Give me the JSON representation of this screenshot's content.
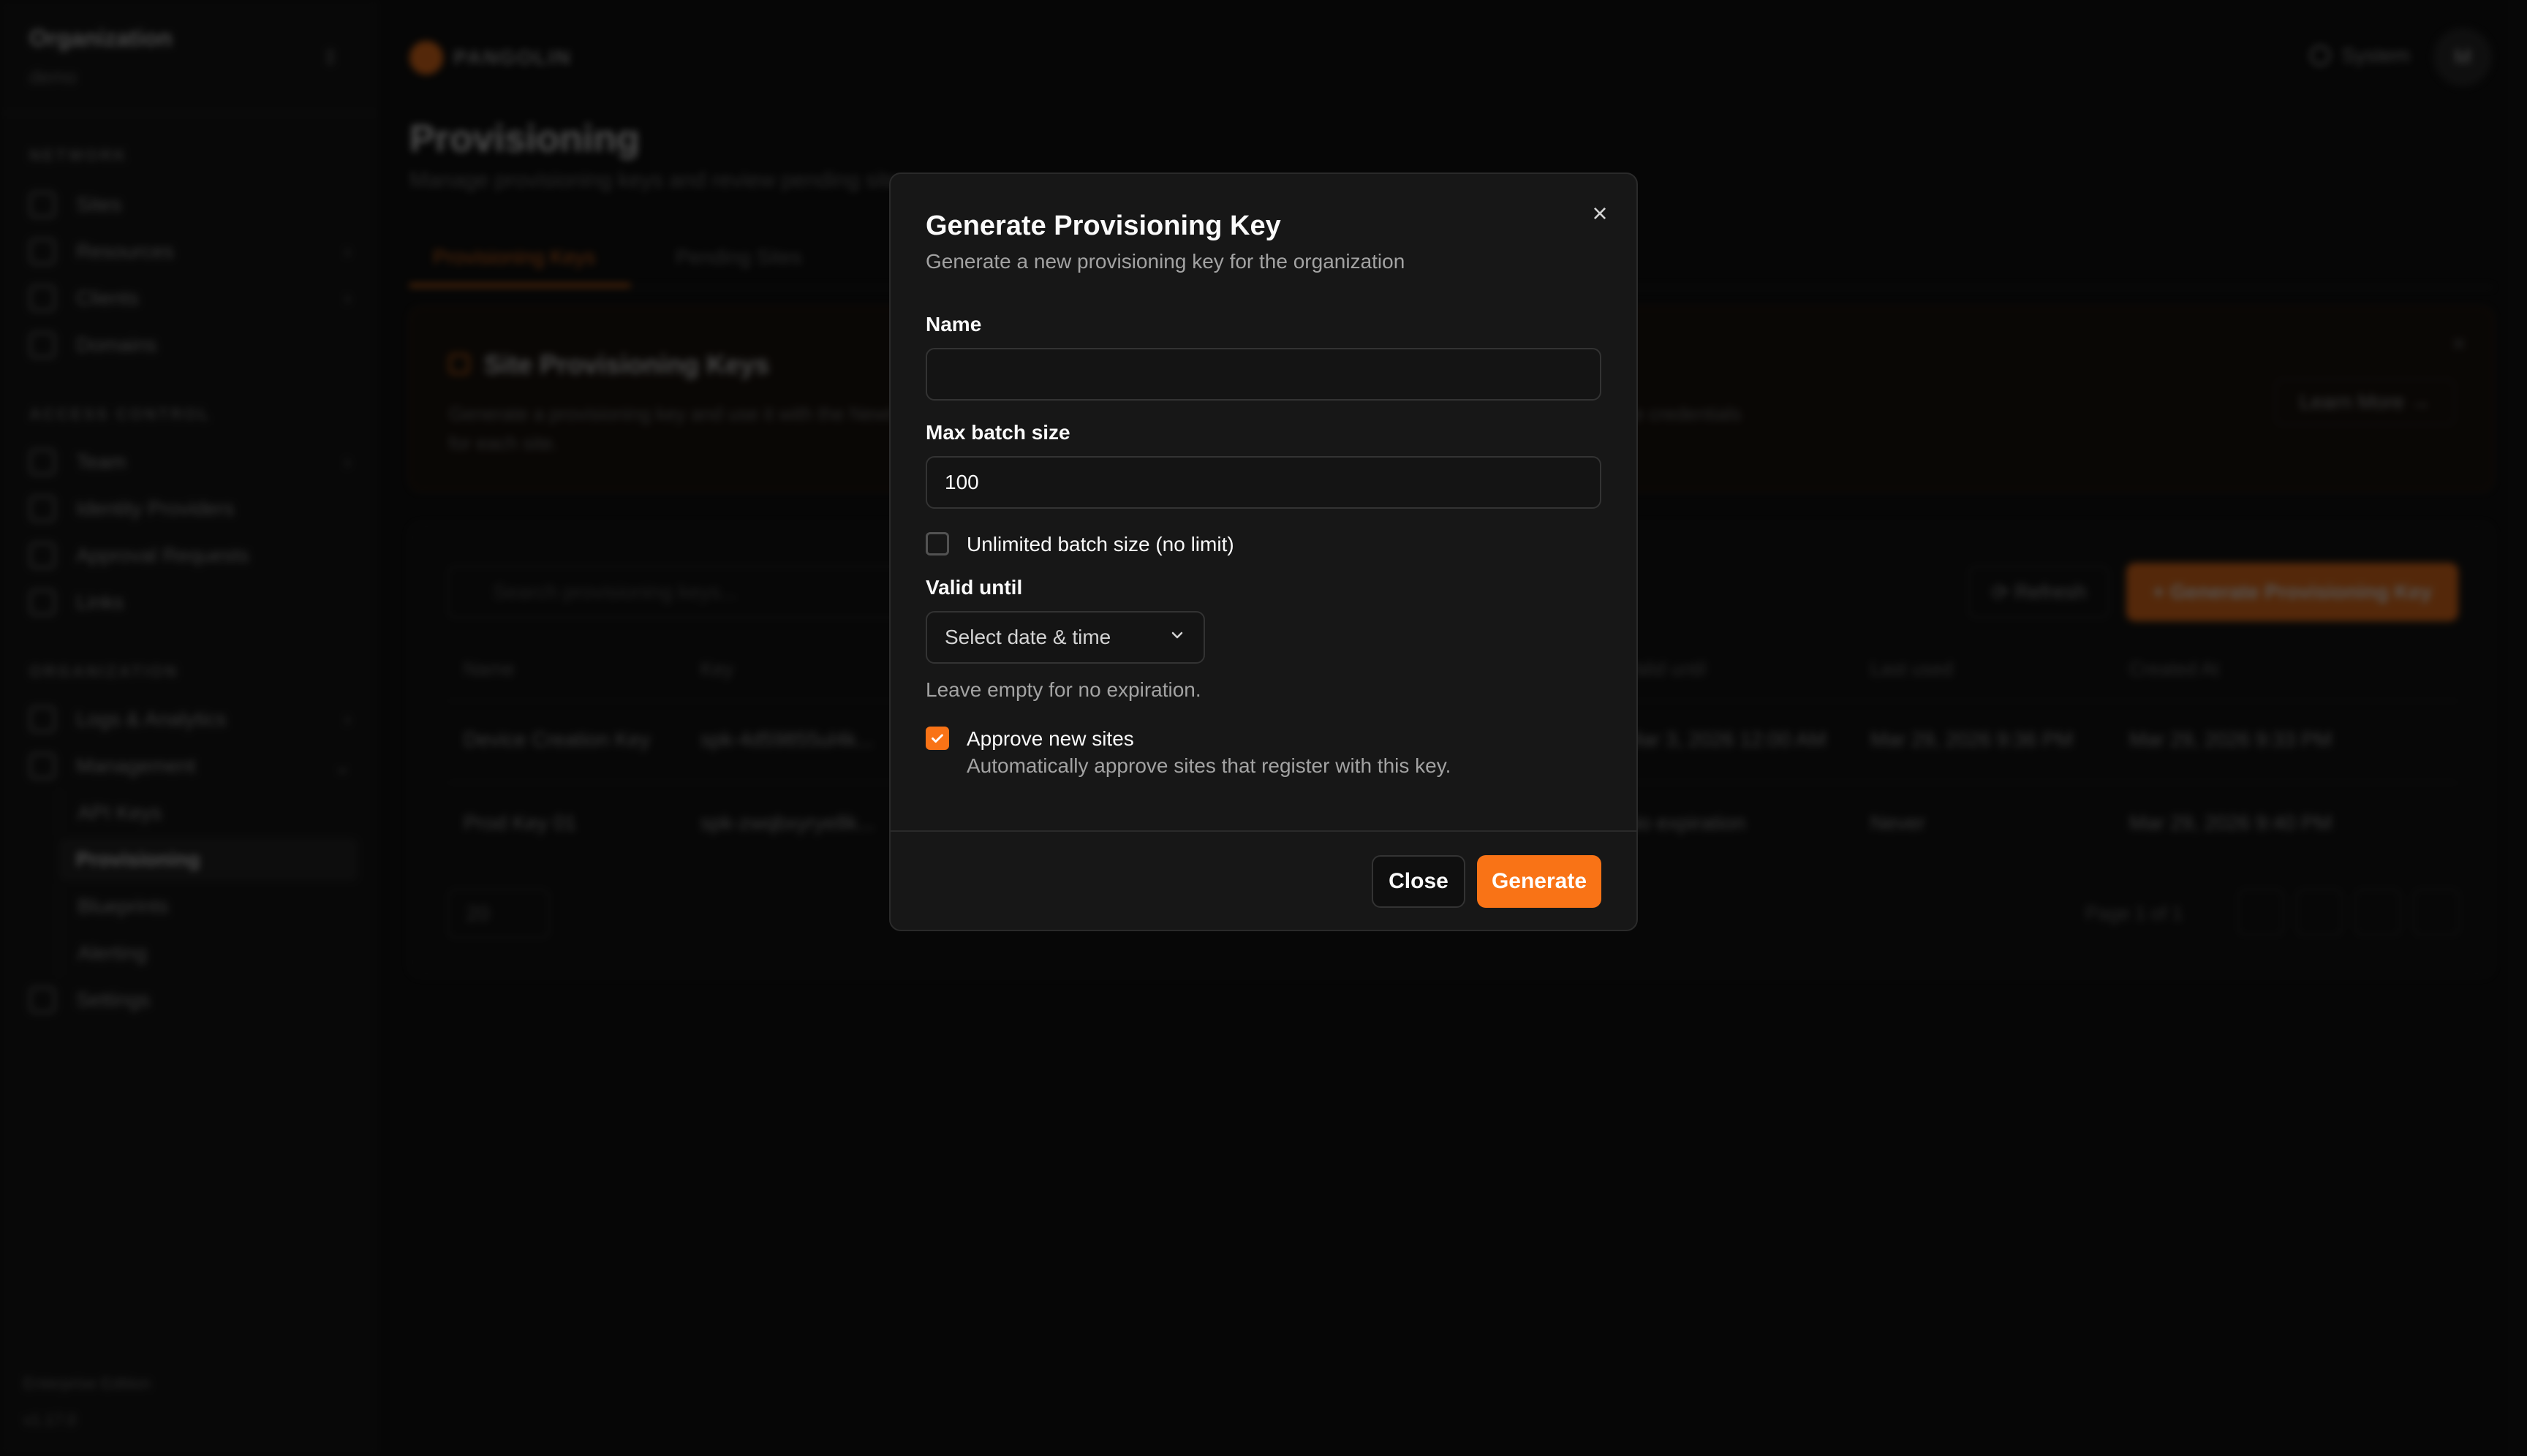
{
  "sidebar": {
    "org_title": "Organization",
    "org_sub": "demo",
    "sections": {
      "network": "NETWORK",
      "access_control": "ACCESS CONTROL",
      "organization": "ORGANIZATION"
    },
    "items": {
      "sites": "Sites",
      "resources": "Resources",
      "clients": "Clients",
      "domains": "Domains",
      "team": "Team",
      "identity_providers": "Identity Providers",
      "approval_requests": "Approval Requests",
      "links": "Links",
      "logs": "Logs & Analytics",
      "management": "Management",
      "api_keys": "API Keys",
      "provisioning": "Provisioning",
      "blueprints": "Blueprints",
      "alerting": "Alerting",
      "settings": "Settings"
    },
    "footer_edition": "Enterprise Edition",
    "footer_version": "v1.17.0"
  },
  "topbar": {
    "logo_text": "PANGOLIN",
    "theme_label": "System",
    "avatar_initial": "M"
  },
  "page": {
    "title": "Provisioning",
    "description": "Manage provisioning keys and review pending sites",
    "tabs": [
      "Provisioning Keys",
      "Pending Sites"
    ],
    "banner": {
      "title": "Site Provisioning Keys",
      "body": "Generate a provisioning key and use it with the Newt connector to automatically create sites on first startup. This simplifies setting up separate credentials for each site.",
      "learn_more": "Learn More"
    },
    "table": {
      "search_placeholder": "Search provisioning keys...",
      "refresh": "Refresh",
      "generate": "Generate Provisioning Key",
      "headers": [
        "Name",
        "Key",
        "Valid until",
        "Last used",
        "Created At"
      ],
      "rows": [
        [
          "Device Creation Key",
          "spk-4d59855ul4k...",
          "Mar 3, 2026 12:00 AM",
          "Mar 29, 2026 9:36 PM",
          "Mar 29, 2026 9:33 PM"
        ],
        [
          "Prod Key 01",
          "spk-zwqbxyrye8k...",
          "No expiration",
          "Never",
          "Mar 29, 2026 9:40 PM"
        ]
      ],
      "page_size": "20",
      "page_info": "Page 1 of 1"
    }
  },
  "modal": {
    "title": "Generate Provisioning Key",
    "description": "Generate a new provisioning key for the organization",
    "name_label": "Name",
    "name_value": "",
    "max_batch_label": "Max batch size",
    "max_batch_value": "100",
    "unlimited_label": "Unlimited batch size (no limit)",
    "unlimited_checked": false,
    "valid_until_label": "Valid until",
    "valid_until_placeholder": "Select date & time",
    "valid_until_help": "Leave empty for no expiration.",
    "approve_label": "Approve new sites",
    "approve_help": "Automatically approve sites that register with this key.",
    "approve_checked": true,
    "close_button": "Close",
    "generate_button": "Generate",
    "accent_color": "#f97316"
  }
}
